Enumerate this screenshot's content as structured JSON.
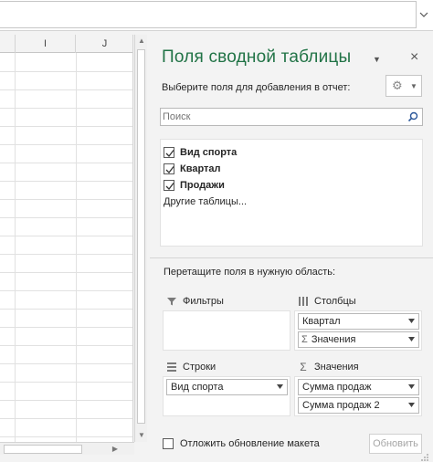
{
  "grid": {
    "columns": [
      "",
      "I",
      "J"
    ]
  },
  "panel": {
    "title": "Поля сводной таблицы",
    "choose_label": "Выберите поля для добавления в отчет:",
    "search_placeholder": "Поиск",
    "fields": [
      {
        "label": "Вид спорта",
        "checked": true
      },
      {
        "label": "Квартал",
        "checked": true
      },
      {
        "label": "Продажи",
        "checked": true
      }
    ],
    "more_tables": "Другие таблицы...",
    "drag_label": "Перетащите поля в нужную область:",
    "areas": {
      "filters": {
        "label": "Фильтры",
        "items": []
      },
      "columns": {
        "label": "Столбцы",
        "items": [
          "Квартал",
          "Значения"
        ]
      },
      "rows": {
        "label": "Строки",
        "items": [
          "Вид спорта"
        ]
      },
      "values": {
        "label": "Значения",
        "items": [
          "Сумма продаж",
          "Сумма продаж 2"
        ]
      }
    },
    "defer_label": "Отложить обновление макета",
    "update_label": "Обновить"
  },
  "colors": {
    "accent": "#217346",
    "panel_bg": "#f3f3f3"
  },
  "icons": {
    "settings": "gear-icon",
    "search": "search-icon",
    "close": "close-icon"
  }
}
